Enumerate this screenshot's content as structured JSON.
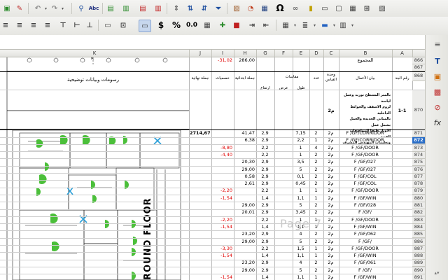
{
  "formula_bar": {
    "content": ""
  },
  "toolbar": {
    "special_char": "Ω",
    "currency": "$",
    "percent": "%",
    "decimal": "0.0",
    "spell": "Abc"
  },
  "columns": [
    "K",
    "J",
    "I",
    "H",
    "G",
    "F",
    "E",
    "D",
    "C",
    "B",
    "A"
  ],
  "drawing": {
    "title": "رسومات وبيانات توضيحية",
    "floor_label": "ROUND FLOOR",
    "watermark": "Page 7",
    "marker_k": "K"
  },
  "header_row": {
    "j": "جملة نهائية",
    "i": "خصميات",
    "h": "جملة ابتدائية",
    "g": "ارتفاع",
    "f_top": "مقاسات",
    "f": "عرض",
    "e": "طول",
    "d": "عدد",
    "c": "وحدة القياس",
    "b": "بيان الأعمال",
    "a": "رقم البند"
  },
  "row866": {
    "a": "866",
    "b": "المجموع",
    "i": "-31,02",
    "h": "286,00"
  },
  "row867": {
    "a": "867"
  },
  "row868": {
    "a": "868"
  },
  "row870": {
    "a": "870",
    "ref": "1-1",
    "unit": "م2",
    "desc_lines": [
      "بالمتر المسطح توريد وعمل لياسة",
      "لزوم الاسقف والحوائط الداخلية",
      "بالمباني الجديدة والعمل يشمل عمل",
      "الاوتار طبقا للمواصفات الفنية",
      "وتعليمات المهندس المشرف"
    ]
  },
  "rows": [
    {
      "n": "871",
      "j": "2714,67",
      "i": "",
      "h": "41,47",
      "g": "2,9",
      "e": "7,15",
      "d": "2",
      "c": "م2",
      "b": "F /GF/CORRIDOR"
    },
    {
      "n": "872",
      "j": "",
      "i": "",
      "h": "6,38",
      "g": "2,9",
      "e": "2,2",
      "d": "1",
      "c": "م2",
      "b": "F /GF/CORRIDOR"
    },
    {
      "n": "873",
      "j": "",
      "i": "-8,80",
      "h": "",
      "g": "2,2",
      "e": "1",
      "d": "4",
      "c": "م2",
      "b": "F /GF/DOOR"
    },
    {
      "n": "874",
      "j": "",
      "i": "-4,40",
      "h": "",
      "g": "2,2",
      "e": "1",
      "d": "2",
      "c": "م2",
      "b": "F /GF/DOOR"
    },
    {
      "n": "875",
      "j": "",
      "i": "",
      "h": "20,30",
      "g": "2,9",
      "e": "3,5",
      "d": "2",
      "c": "م2",
      "b": "F /GF/027"
    },
    {
      "n": "876",
      "j": "",
      "i": "",
      "h": "29,00",
      "g": "2,9",
      "e": "5",
      "d": "2",
      "c": "م2",
      "b": "F /GF/027"
    },
    {
      "n": "877",
      "j": "",
      "i": "",
      "h": "0,58",
      "g": "2,9",
      "e": "0,1",
      "d": "2",
      "c": "م2",
      "b": "F /GF/COL"
    },
    {
      "n": "878",
      "j": "",
      "i": "",
      "h": "2,61",
      "g": "2,9",
      "e": "0,45",
      "d": "2",
      "c": "م2",
      "b": "F /GF/COL"
    },
    {
      "n": "879",
      "j": "",
      "i": "-2,20",
      "h": "",
      "g": "2,2",
      "e": "1",
      "d": "1",
      "c": "م2",
      "b": "F /GF/DOOR"
    },
    {
      "n": "880",
      "j": "",
      "i": "-1,54",
      "h": "",
      "g": "1,4",
      "e": "1,1",
      "d": "1",
      "c": "م2",
      "b": "F /GF/WIN"
    },
    {
      "n": "881",
      "j": "",
      "i": "",
      "h": "29,00",
      "g": "2,9",
      "e": "5",
      "d": "2",
      "c": "م2",
      "b": "F /GF/028"
    },
    {
      "n": "882",
      "j": "",
      "i": "",
      "h": "20,01",
      "g": "2,9",
      "e": "3,45",
      "d": "2",
      "c": "م2",
      "b": "F /GF/"
    },
    {
      "n": "883",
      "j": "",
      "i": "-2,20",
      "h": "",
      "g": "2,2",
      "e": "1",
      "d": "1",
      "c": "م2",
      "b": "F /GF/DOOR"
    },
    {
      "n": "884",
      "j": "",
      "i": "-1,54",
      "h": "",
      "g": "1,4",
      "e": "1,1",
      "d": "1",
      "c": "م2",
      "b": "F /GF/WIN"
    },
    {
      "n": "885",
      "j": "",
      "i": "",
      "h": "23,20",
      "g": "2,9",
      "e": "4",
      "d": "2",
      "c": "م2",
      "b": "F /GF/062"
    },
    {
      "n": "886",
      "j": "",
      "i": "",
      "h": "29,00",
      "g": "2,9",
      "e": "5",
      "d": "2",
      "c": "م2",
      "b": "F /GF/"
    },
    {
      "n": "887",
      "j": "",
      "i": "-3,30",
      "h": "",
      "g": "2,2",
      "e": "1,5",
      "d": "1",
      "c": "م2",
      "b": "F /GF/DOOR"
    },
    {
      "n": "888",
      "j": "",
      "i": "-1,54",
      "h": "",
      "g": "1,4",
      "e": "1,1",
      "d": "1",
      "c": "م2",
      "b": "F /GF/WIN"
    },
    {
      "n": "889",
      "j": "",
      "i": "",
      "h": "23,20",
      "g": "2,9",
      "e": "4",
      "d": "2",
      "c": "م2",
      "b": "F /GF/061"
    },
    {
      "n": "890",
      "j": "",
      "i": "",
      "h": "29,00",
      "g": "2,9",
      "e": "5",
      "d": "2",
      "c": "م2",
      "b": "F /GF/"
    },
    {
      "n": "891",
      "j": "",
      "i": "-1,54",
      "h": "",
      "g": "1,4",
      "e": "1,1",
      "d": "1",
      "c": "م2",
      "b": "F /GF/WIN"
    }
  ],
  "colors": {
    "negative": "#e00000",
    "selected_row": "#2a6ec8"
  }
}
